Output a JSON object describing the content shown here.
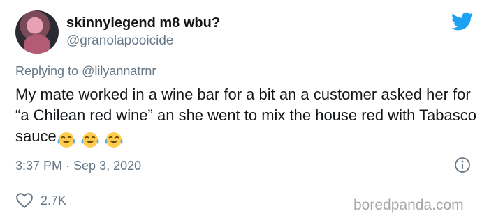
{
  "tweet": {
    "display_name": "skinnylegend m8 wbu?",
    "handle": "@granolapooicide",
    "replying_prefix": "Replying to",
    "replying_to": "@lilyannatrnr",
    "text": "My mate worked in a wine bar for a bit an a customer asked her for “a Chilean red wine” an she went to mix the house red with Tabasco sauce",
    "emojis": [
      "face-with-tears-of-joy-icon",
      "face-with-tears-of-joy-icon",
      "face-with-tears-of-joy-icon"
    ],
    "timestamp": "3:37 PM · Sep 3, 2020",
    "like_count": "2.7K"
  },
  "icons": {
    "brand": "twitter-bird-icon",
    "info": "info-icon",
    "like": "heart-icon"
  },
  "colors": {
    "twitter_blue": "#1da1f2",
    "secondary_text": "#657786",
    "divider": "#e1e8ed",
    "watermark": "#a8a8a8"
  },
  "watermark": "boredpanda.com"
}
